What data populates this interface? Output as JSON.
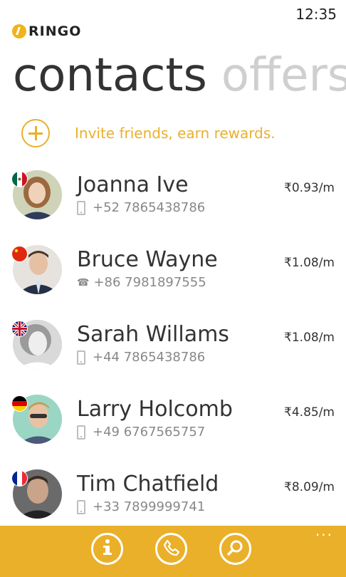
{
  "status": {
    "time": "12:35"
  },
  "app": {
    "name": "RINGO",
    "logo_icon": "ringo-logo-icon"
  },
  "pivot": {
    "active": "contacts",
    "inactive": "offers"
  },
  "invite": {
    "label": "Invite friends, earn rewards.",
    "icon": "plus-icon"
  },
  "contacts": [
    {
      "name": "Joanna Ive",
      "number": "+52 7865438786",
      "rate": "₹0.93/m",
      "flag": "mexico",
      "phone_type": "mobile"
    },
    {
      "name": "Bruce Wayne",
      "number": "+86 7981897555",
      "rate": "₹1.08/m",
      "flag": "china",
      "phone_type": "landline"
    },
    {
      "name": "Sarah Willams",
      "number": "+44 7865438786",
      "rate": "₹1.08/m",
      "flag": "uk",
      "phone_type": "mobile"
    },
    {
      "name": "Larry Holcomb",
      "number": "+49 6767565757",
      "rate": "₹4.85/m",
      "flag": "germany",
      "phone_type": "mobile"
    },
    {
      "name": "Tim Chatfield",
      "number": "+33 7899999741",
      "rate": "₹8.09/m",
      "flag": "france",
      "phone_type": "mobile"
    }
  ],
  "appbar": {
    "buttons": [
      "info-icon",
      "phone-icon",
      "search-icon"
    ],
    "more": "..."
  },
  "colors": {
    "accent": "#eab02a",
    "text": "#333333",
    "muted": "#888888",
    "pivot_inactive": "#cfcfcf"
  }
}
